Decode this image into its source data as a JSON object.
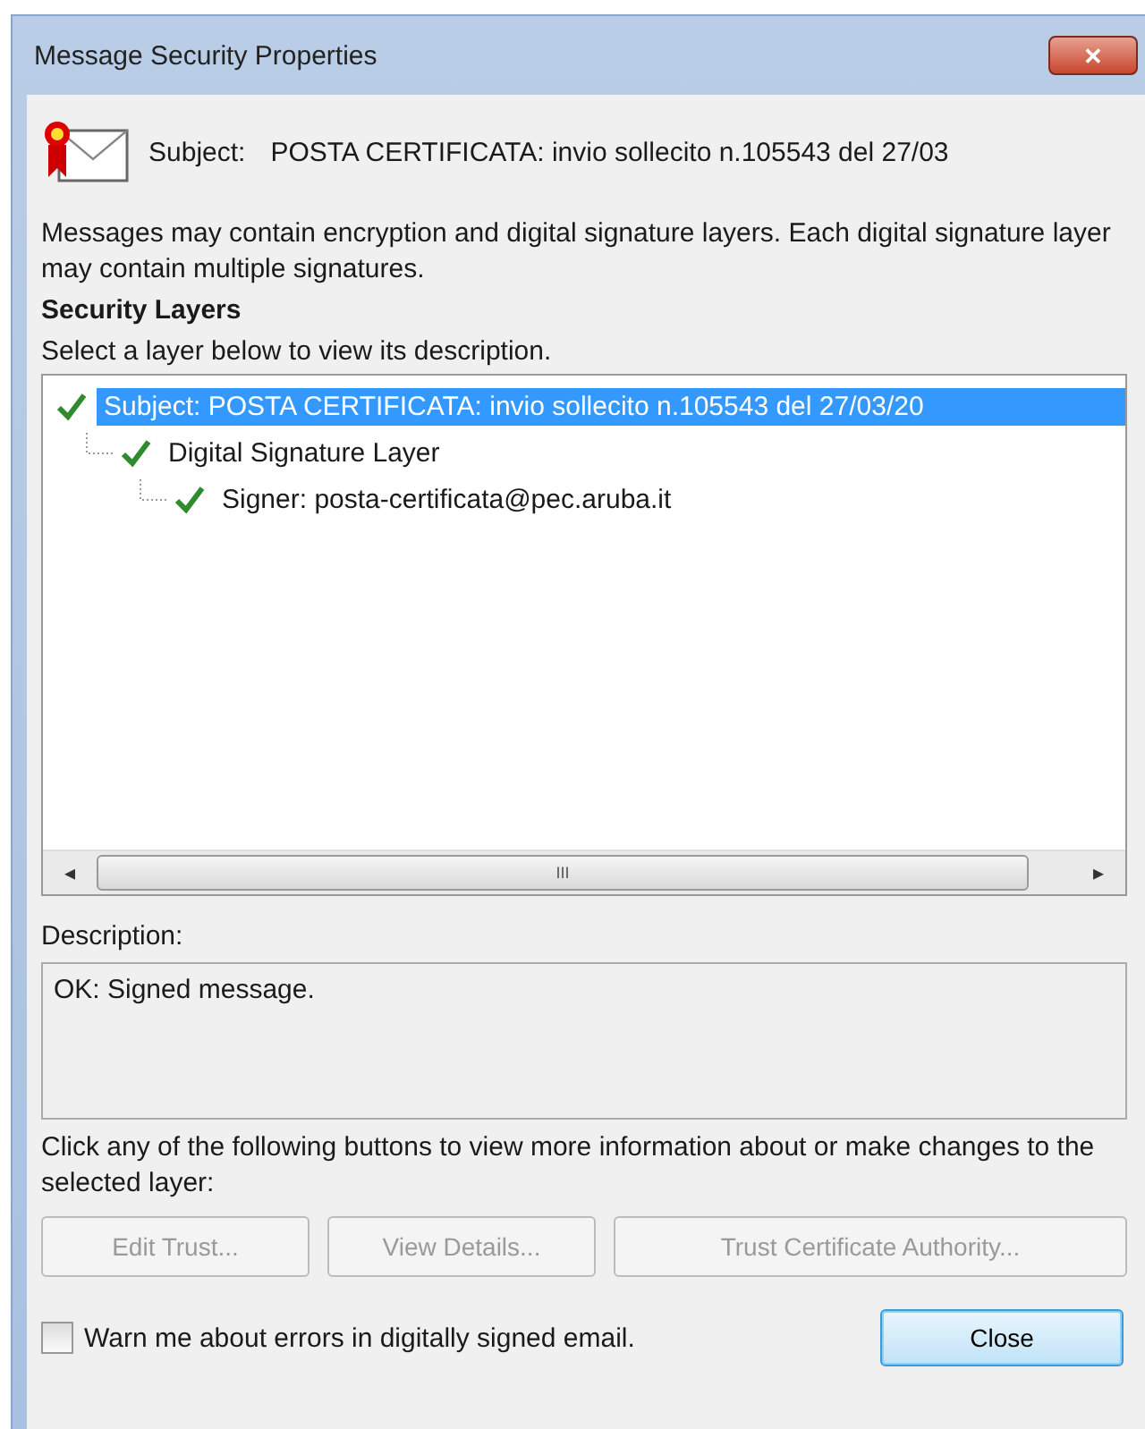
{
  "window": {
    "title": "Message Security Properties",
    "close_glyph": "✕"
  },
  "subject": {
    "label": "Subject:",
    "value": "POSTA CERTIFICATA: invio sollecito n.105543 del 27/03"
  },
  "intro": "Messages may contain encryption and digital signature layers. Each digital signature layer may contain multiple signatures.",
  "security_layers": {
    "heading": "Security Layers",
    "hint": "Select a layer below to view its description.",
    "tree": [
      {
        "label": "Subject: POSTA CERTIFICATA: invio sollecito n.105543 del 27/03/20",
        "valid": true,
        "selected": true,
        "children": [
          {
            "label": "Digital Signature Layer",
            "valid": true,
            "selected": false,
            "children": [
              {
                "label": "Signer: posta-certificata@pec.aruba.it",
                "valid": true,
                "selected": false
              }
            ]
          }
        ]
      }
    ],
    "scrollbar": {
      "left": "◂",
      "right": "▸",
      "grip": "III"
    }
  },
  "description": {
    "label": "Description:",
    "text": "OK: Signed message."
  },
  "buttons_hint": "Click any of the following buttons to view more information about or make changes to the selected layer:",
  "buttons": [
    {
      "label": "Edit Trust...",
      "disabled": true
    },
    {
      "label": "View Details...",
      "disabled": true
    },
    {
      "label": "Trust Certificate Authority...",
      "disabled": true
    }
  ],
  "warn_checkbox": {
    "label": "Warn me about errors in digitally signed email.",
    "checked": false
  },
  "close_button": {
    "label": "Close",
    "default": true
  }
}
